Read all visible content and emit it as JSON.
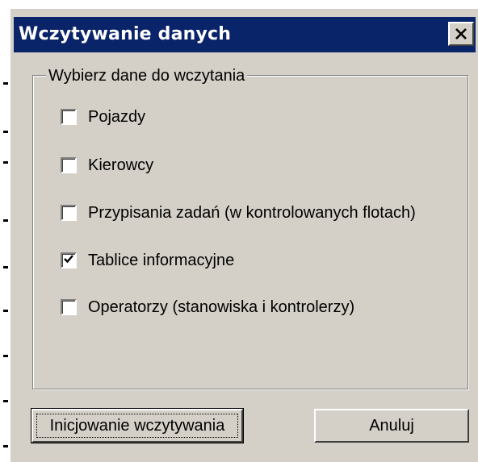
{
  "dialog": {
    "title": "Wczytywanie danych",
    "close_icon": "close-icon"
  },
  "group": {
    "legend": "Wybierz dane do wczytania",
    "options": [
      {
        "label": "Pojazdy",
        "checked": false
      },
      {
        "label": "Kierowcy",
        "checked": false
      },
      {
        "label": "Przypisania zadań (w kontrolowanych flotach)",
        "checked": false
      },
      {
        "label": "Tablice informacyjne",
        "checked": true
      },
      {
        "label": "Operatorzy (stanowiska i kontrolerzy)",
        "checked": false
      }
    ]
  },
  "buttons": {
    "start_label": "Inicjowanie wczytywania",
    "cancel_label": "Anuluj"
  },
  "colors": {
    "titlebar": "#0a246a",
    "face": "#d4d0c8"
  }
}
